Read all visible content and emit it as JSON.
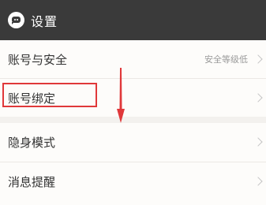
{
  "header": {
    "title": "设置",
    "icon": "chat-bubble-icon",
    "background": "#3a3a3a"
  },
  "section1": {
    "items": [
      {
        "label": "账号与安全",
        "value": "安全等级低"
      },
      {
        "label": "账号绑定",
        "value": ""
      }
    ]
  },
  "section2": {
    "items": [
      {
        "label": "隐身模式"
      },
      {
        "label": "消息提醒"
      }
    ]
  },
  "annotation": {
    "highlight_color": "#e0383a",
    "arrow_icon": "down-arrow-icon"
  }
}
